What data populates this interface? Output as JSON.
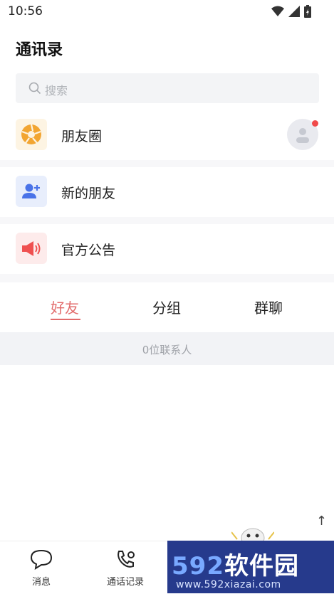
{
  "status_bar": {
    "time": "10:56"
  },
  "page": {
    "title": "通讯录"
  },
  "search": {
    "placeholder": "搜索"
  },
  "rows": [
    {
      "label": "朋友圈",
      "icon": "aperture-icon",
      "color": "#f2a532",
      "bg": "#fdf4e3"
    },
    {
      "label": "新的朋友",
      "icon": "add-user-icon",
      "color": "#4a73e8",
      "bg": "#e8eefc"
    },
    {
      "label": "官方公告",
      "icon": "megaphone-icon",
      "color": "#ef5050",
      "bg": "#fdebeb"
    }
  ],
  "tabs": [
    {
      "label": "好友",
      "active": true
    },
    {
      "label": "分组",
      "active": false
    },
    {
      "label": "群聊",
      "active": false
    }
  ],
  "contacts": {
    "count_text": "0位联系人"
  },
  "bottom_nav": [
    {
      "label": "消息",
      "icon": "chat-bubble-icon"
    },
    {
      "label": "通话记录",
      "icon": "phone-call-icon"
    }
  ],
  "scroll_top_symbol": "↑",
  "watermark": {
    "digits": "592",
    "brand": "软件园",
    "url": "www.592xiazai.com"
  },
  "colors": {
    "accent": "#e26b6b",
    "badge": "#f04a4a"
  }
}
